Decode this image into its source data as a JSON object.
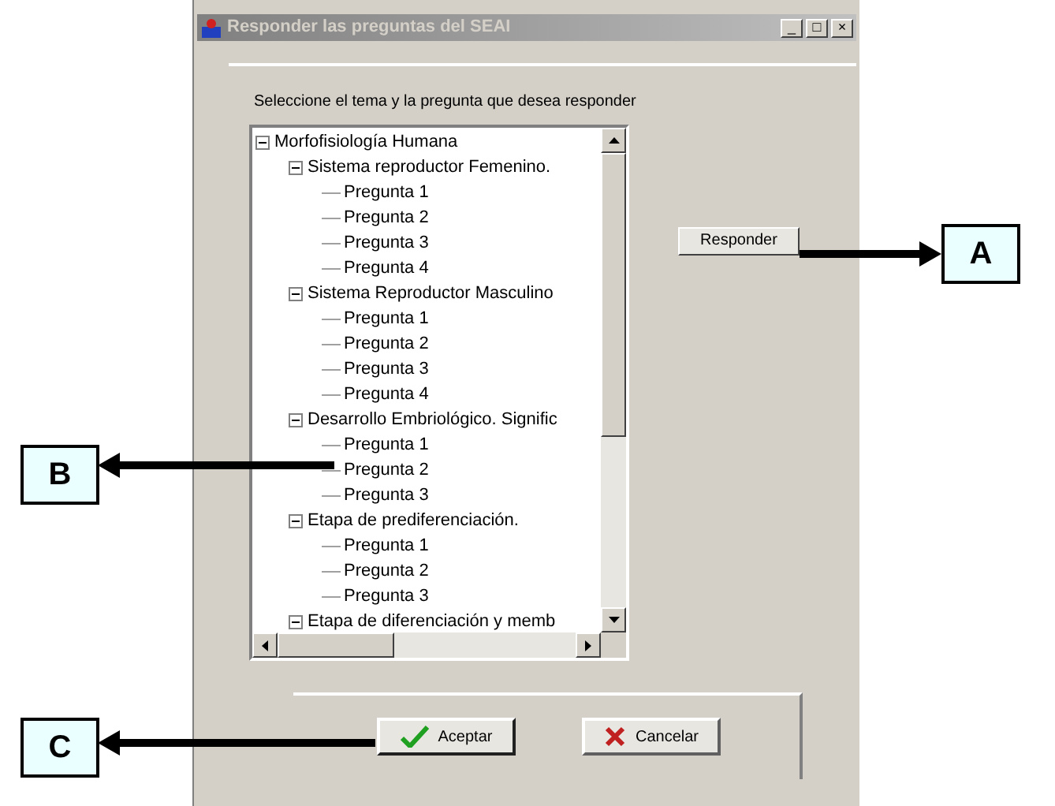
{
  "window": {
    "title": "Responder las preguntas del SEAI",
    "controls": [
      "_",
      "□",
      "×"
    ]
  },
  "prompt": "Seleccione el tema y la pregunta que desea responder",
  "tree": [
    {
      "label": "Morfofisiología Humana",
      "expanded": true,
      "children": [
        {
          "label": "Sistema reproductor Femenino.",
          "expanded": true,
          "children": [
            {
              "label": "Pregunta 1"
            },
            {
              "label": "Pregunta 2"
            },
            {
              "label": "Pregunta 3"
            },
            {
              "label": "Pregunta 4"
            }
          ]
        },
        {
          "label": "Sistema Reproductor Masculino",
          "expanded": true,
          "children": [
            {
              "label": "Pregunta 1"
            },
            {
              "label": "Pregunta 2"
            },
            {
              "label": "Pregunta 3"
            },
            {
              "label": "Pregunta 4"
            }
          ]
        },
        {
          "label": "Desarrollo Embriológico. Signific",
          "expanded": true,
          "children": [
            {
              "label": "Pregunta 1"
            },
            {
              "label": "Pregunta 2"
            },
            {
              "label": "Pregunta 3"
            }
          ]
        },
        {
          "label": "Etapa de prediferenciación.",
          "expanded": true,
          "children": [
            {
              "label": "Pregunta 1"
            },
            {
              "label": "Pregunta 2"
            },
            {
              "label": "Pregunta 3"
            }
          ]
        },
        {
          "label": "Etapa de diferenciación y memb",
          "expanded": true
        }
      ]
    }
  ],
  "buttons": {
    "respond": "Responder",
    "ok": "Aceptar",
    "cancel": "Cancelar"
  },
  "callouts": [
    {
      "letter": "A"
    },
    {
      "letter": "B"
    },
    {
      "letter": "C"
    }
  ]
}
